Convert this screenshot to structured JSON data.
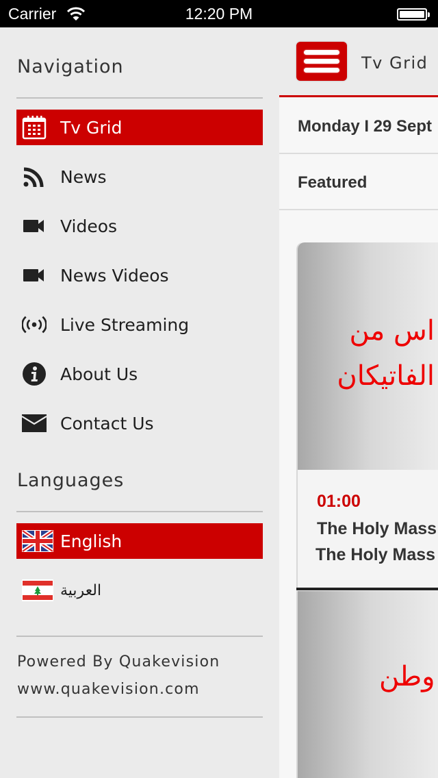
{
  "status_bar": {
    "carrier": "Carrier",
    "time": "12:20 PM",
    "battery_level": 1.0
  },
  "sidebar": {
    "navigation_title": "Navigation",
    "nav_items": [
      {
        "label": "Tv Grid",
        "icon": "calendar-icon",
        "active": true
      },
      {
        "label": "News",
        "icon": "rss-icon",
        "active": false
      },
      {
        "label": "Videos",
        "icon": "video-camera-icon",
        "active": false
      },
      {
        "label": "News Videos",
        "icon": "video-camera-icon",
        "active": false
      },
      {
        "label": "Live Streaming",
        "icon": "broadcast-icon",
        "active": false
      },
      {
        "label": "About Us",
        "icon": "info-icon",
        "active": false
      },
      {
        "label": "Contact Us",
        "icon": "envelope-icon",
        "active": false
      }
    ],
    "languages_title": "Languages",
    "languages": [
      {
        "label": "English",
        "icon": "uk-flag-icon",
        "active": true
      },
      {
        "label": "العربية",
        "icon": "lebanon-flag-icon",
        "active": false
      }
    ],
    "footer": {
      "powered_by": "Powered By Quakevision",
      "website": "www.quakevision.com"
    }
  },
  "main": {
    "header_title": "Tv Grid",
    "date_label": "Monday I 29 Sept",
    "section_label": "Featured",
    "cards": [
      {
        "thumb_text_line1": "اس من",
        "thumb_text_line2": "الفاتيكان",
        "time": "01:00",
        "title": "The Holy Mass",
        "subtitle": "The Holy Mass"
      },
      {
        "thumb_text_line1": "الة وطن"
      }
    ]
  },
  "colors": {
    "accent": "#cc0000",
    "sidebar_bg": "#ebebeb",
    "panel_bg": "#f7f7f7",
    "text": "#333333"
  }
}
